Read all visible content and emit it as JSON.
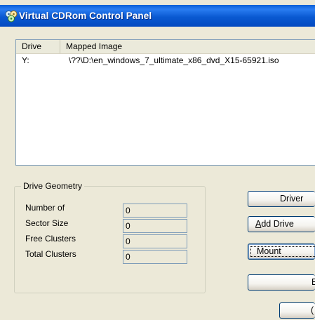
{
  "window": {
    "title": "Virtual CDRom Control Panel",
    "icon": "cdrom-app-icon"
  },
  "list": {
    "columns": [
      "Drive",
      "Mapped Image"
    ],
    "rows": [
      {
        "drive": "Y:",
        "image": "\\??\\D:\\en_windows_7_ultimate_x86_dvd_X15-65921.iso"
      }
    ]
  },
  "geometry": {
    "title": "Drive Geometry",
    "fields": [
      {
        "label": "Number of",
        "value": "0"
      },
      {
        "label": "Sector Size",
        "value": "0"
      },
      {
        "label": "Free Clusters",
        "value": "0"
      },
      {
        "label": "Total Clusters",
        "value": "0"
      }
    ]
  },
  "buttons": {
    "driver": "Driver",
    "add_drive_mnemonic": "A",
    "add_drive_rest": "dd Drive",
    "mount": "Mount",
    "partial1": "E",
    "partial2": "("
  },
  "colors": {
    "titlebar": "#0a5ad2",
    "face": "#ece9d8",
    "border": "#7f9db9"
  }
}
